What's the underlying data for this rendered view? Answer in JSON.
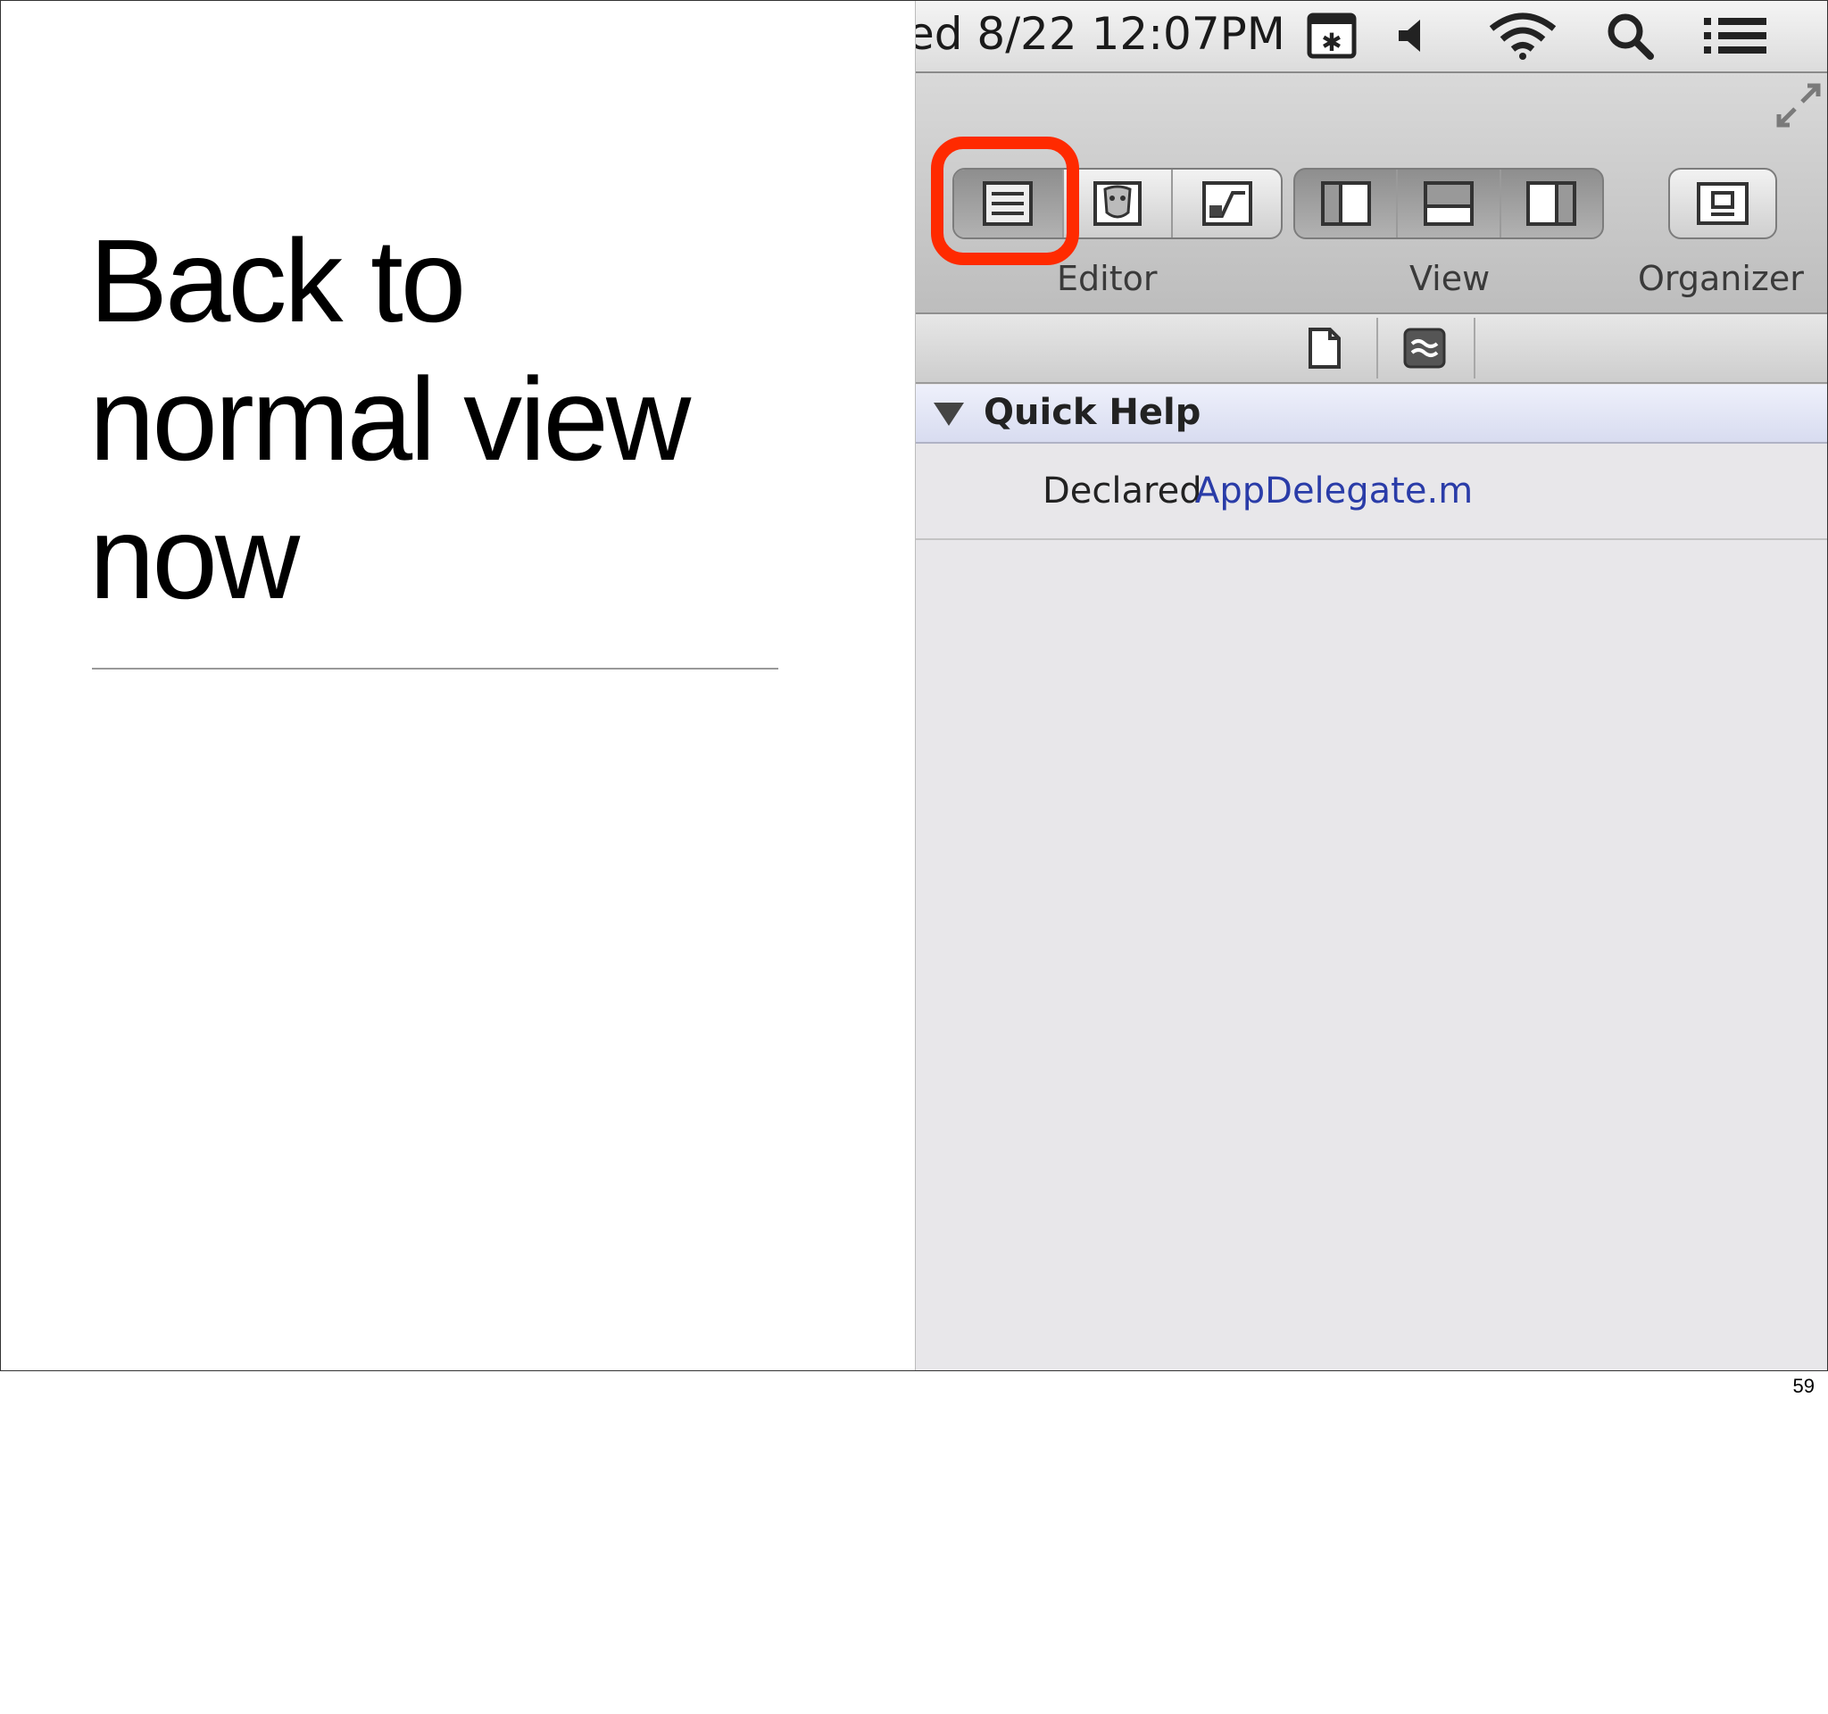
{
  "slide": {
    "title_lines": [
      "Back to",
      "normal view",
      "now"
    ],
    "page_number": "59"
  },
  "screenshot": {
    "menubar": {
      "clock": "ed 8/22  12:07PM"
    },
    "toolbar": {
      "editor_label": "Editor",
      "view_label": "View",
      "organizer_label": "Organizer",
      "highlight_color": "#ff2a00"
    },
    "quick_help": {
      "title": "Quick Help",
      "declared_label": "Declared",
      "declared_value": "AppDelegate.m",
      "link_color": "#2a3ca8"
    }
  }
}
